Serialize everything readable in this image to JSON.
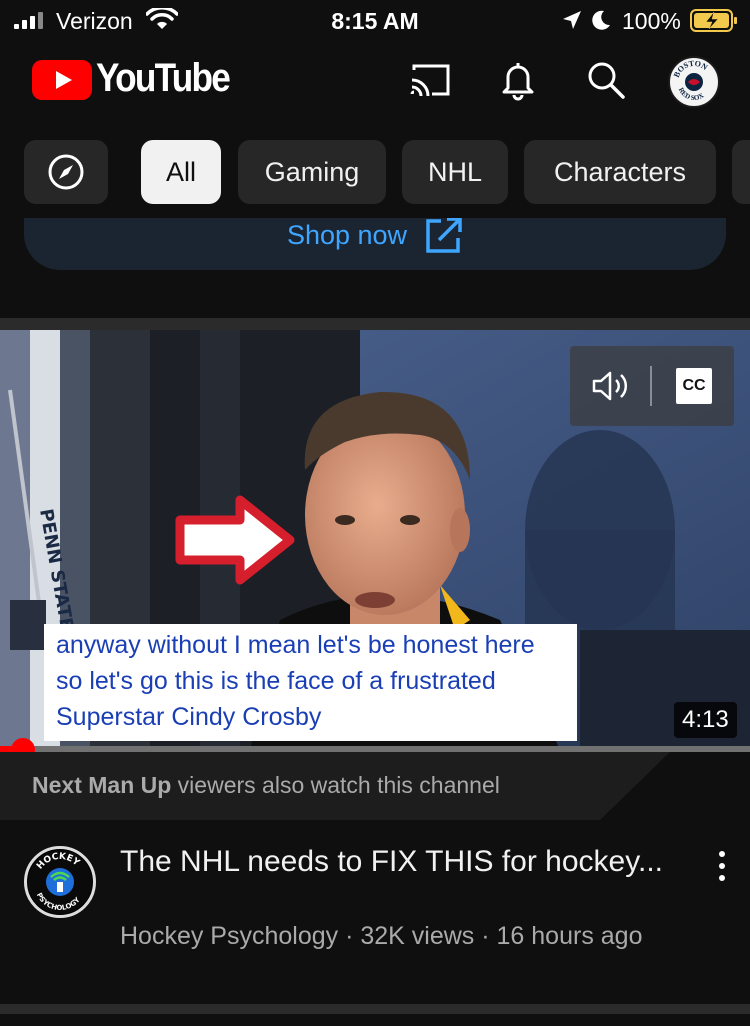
{
  "status_bar": {
    "carrier": "Verizon",
    "time": "8:15 AM",
    "battery": "100%",
    "icons": [
      "signal-icon",
      "wifi-icon",
      "location-icon",
      "moon-icon",
      "battery-charging-icon"
    ]
  },
  "header": {
    "logo_text": "YouTube",
    "icons": [
      "cast-icon",
      "bell-icon",
      "search-icon",
      "account-avatar"
    ],
    "avatar_text_top": "BOSTON",
    "avatar_text_bottom": "RED SOX"
  },
  "chips": [
    {
      "label": "All",
      "active": true
    },
    {
      "label": "Gaming"
    },
    {
      "label": "NHL"
    },
    {
      "label": "Characters"
    }
  ],
  "shop": {
    "label": "Shop now",
    "icon": "external-link-icon"
  },
  "player": {
    "caption": "anyway without I mean let's be honest here so let's go this is the face of a frustrated Superstar Cindy Crosby",
    "duration": "4:13",
    "cc_label": "CC",
    "progress_fraction": 0.03,
    "scene_text": "PENN STATE"
  },
  "recommendation": {
    "channel": "Next Man Up",
    "text": " viewers also watch this channel"
  },
  "video": {
    "title": "The NHL needs to FIX THIS for hockey...",
    "channel": "Hockey Psychology",
    "views": "32K views",
    "age": "16 hours ago",
    "meta": "Hockey Psychology · 32K views · 16 hours ago",
    "avatar_text_top": "HOCKEY",
    "avatar_text_bottom": "PSYCHOLOGY"
  },
  "colors": {
    "background": "#0f0f0f",
    "youtube_red": "#ff0000",
    "link_blue": "#3ea6ff",
    "chip": "#272727",
    "caption_text": "#1a3fb5"
  }
}
